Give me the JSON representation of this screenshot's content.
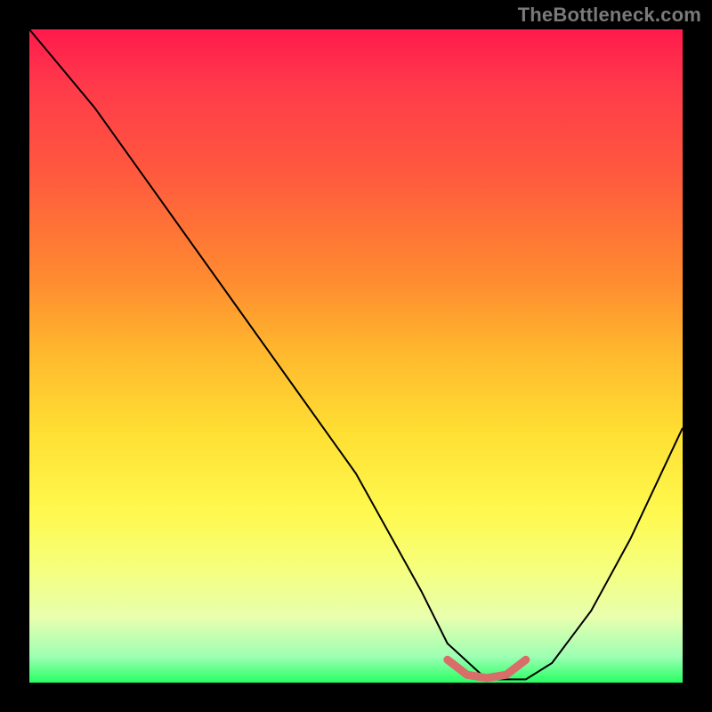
{
  "attribution": "TheBottleneck.com",
  "chart_data": {
    "type": "line",
    "title": "",
    "xlabel": "",
    "ylabel": "",
    "xlim": [
      0,
      100
    ],
    "ylim": [
      0,
      100
    ],
    "series": [
      {
        "name": "bottleneck-curve",
        "x": [
          0,
          5,
          10,
          20,
          30,
          40,
          50,
          60,
          64,
          70,
          76,
          80,
          86,
          92,
          100
        ],
        "values": [
          100,
          94,
          88,
          74,
          60,
          46,
          32,
          14,
          6,
          0.5,
          0.5,
          3,
          11,
          22,
          39
        ],
        "color": "#000000",
        "stroke_width": 2
      },
      {
        "name": "optimal-range",
        "x": [
          64,
          67,
          70,
          73,
          76
        ],
        "values": [
          3.5,
          1.2,
          0.7,
          1.2,
          3.5
        ],
        "color": "#d96d6a",
        "stroke_width": 9
      }
    ],
    "background_gradient_stops": [
      {
        "pos": 0,
        "color": "#ff1a4d"
      },
      {
        "pos": 9,
        "color": "#ff3b4a"
      },
      {
        "pos": 22,
        "color": "#ff593e"
      },
      {
        "pos": 38,
        "color": "#ff8a30"
      },
      {
        "pos": 50,
        "color": "#ffba2e"
      },
      {
        "pos": 62,
        "color": "#ffe033"
      },
      {
        "pos": 74,
        "color": "#fff94f"
      },
      {
        "pos": 82,
        "color": "#f6ff7a"
      },
      {
        "pos": 90,
        "color": "#e8ffae"
      },
      {
        "pos": 96,
        "color": "#9dffb3"
      },
      {
        "pos": 100,
        "color": "#27ff63"
      }
    ]
  }
}
